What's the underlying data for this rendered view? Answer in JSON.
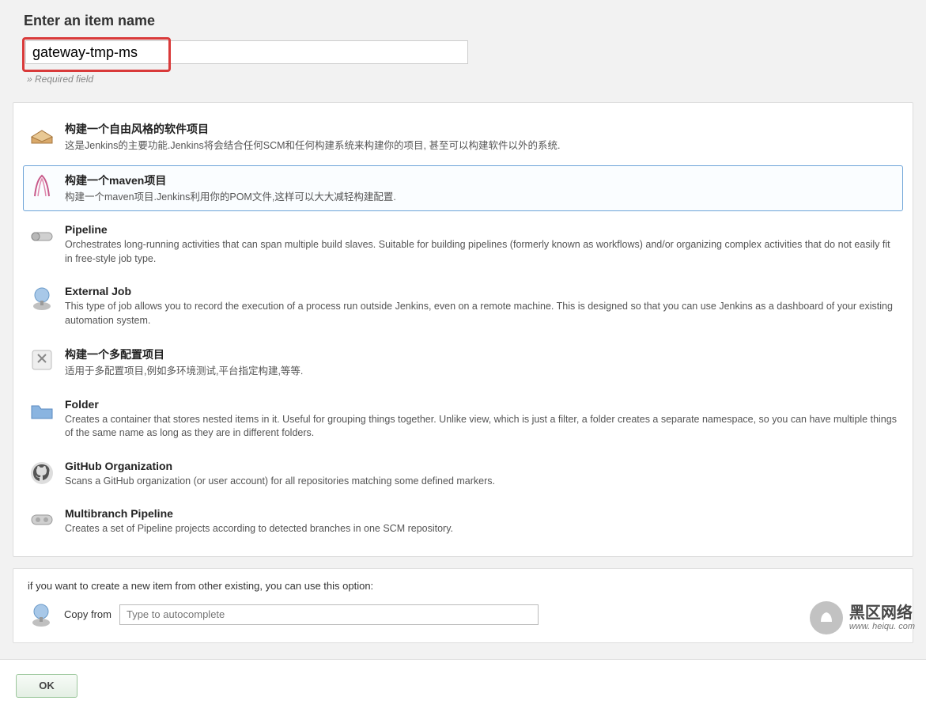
{
  "header": {
    "title": "Enter an item name",
    "required_label": "» Required field"
  },
  "name_input": {
    "value": "gateway-tmp-ms"
  },
  "types": [
    {
      "id": "freestyle",
      "title": "构建一个自由风格的软件项目",
      "desc": "这是Jenkins的主要功能.Jenkins将会结合任何SCM和任何构建系统来构建你的项目, 甚至可以构建软件以外的系统.",
      "selected": false
    },
    {
      "id": "maven",
      "title": "构建一个maven项目",
      "desc": "构建一个maven项目.Jenkins利用你的POM文件,这样可以大大减轻构建配置.",
      "selected": true
    },
    {
      "id": "pipeline",
      "title": "Pipeline",
      "desc": "Orchestrates long-running activities that can span multiple build slaves. Suitable for building pipelines (formerly known as workflows) and/or organizing complex activities that do not easily fit in free-style job type.",
      "selected": false
    },
    {
      "id": "external",
      "title": "External Job",
      "desc": "This type of job allows you to record the execution of a process run outside Jenkins, even on a remote machine. This is designed so that you can use Jenkins as a dashboard of your existing automation system.",
      "selected": false
    },
    {
      "id": "matrix",
      "title": "构建一个多配置项目",
      "desc": "适用于多配置项目,例如多环境测试,平台指定构建,等等.",
      "selected": false
    },
    {
      "id": "folder",
      "title": "Folder",
      "desc": "Creates a container that stores nested items in it. Useful for grouping things together. Unlike view, which is just a filter, a folder creates a separate namespace, so you can have multiple things of the same name as long as they are in different folders.",
      "selected": false
    },
    {
      "id": "github-org",
      "title": "GitHub Organization",
      "desc": "Scans a GitHub organization (or user account) for all repositories matching some defined markers.",
      "selected": false
    },
    {
      "id": "multibranch",
      "title": "Multibranch Pipeline",
      "desc": "Creates a set of Pipeline projects according to detected branches in one SCM repository.",
      "selected": false
    }
  ],
  "copy": {
    "intro": "if you want to create a new item from other existing, you can use this option:",
    "from_label": "Copy from",
    "placeholder": "Type to autocomplete"
  },
  "footer": {
    "ok_label": "OK"
  },
  "watermark": {
    "line1": "黑区网络",
    "line2": "www. heiqu. com"
  }
}
